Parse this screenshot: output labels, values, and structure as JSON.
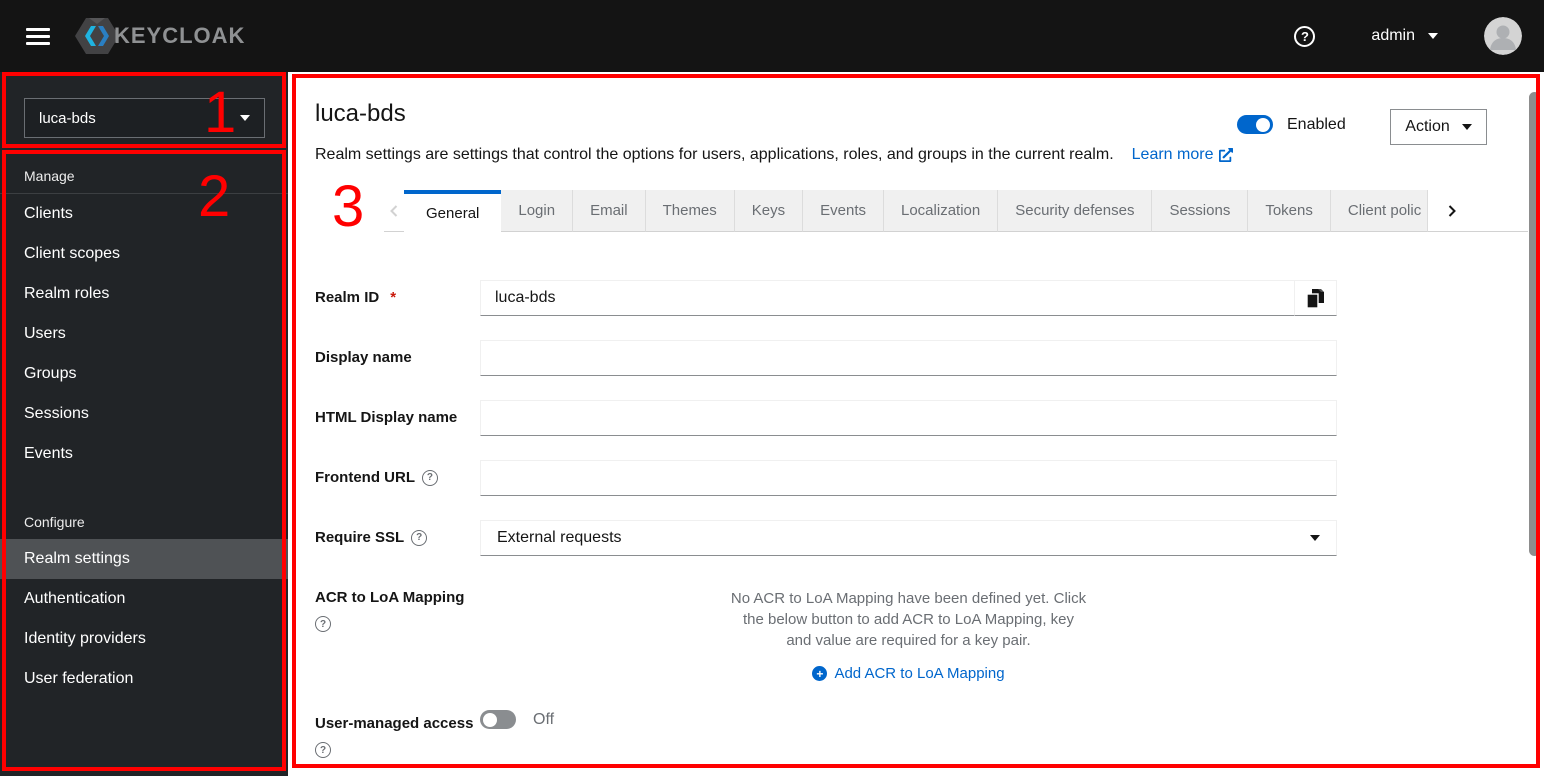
{
  "header": {
    "brand_text": "KEYCLOAK",
    "user_name": "admin"
  },
  "icons": {
    "help": "?",
    "plus": "+"
  },
  "sidebar": {
    "realm_selector": {
      "value": "luca-bds"
    },
    "sections": [
      {
        "title": "Manage",
        "items": [
          {
            "label": "Clients"
          },
          {
            "label": "Client scopes"
          },
          {
            "label": "Realm roles"
          },
          {
            "label": "Users"
          },
          {
            "label": "Groups"
          },
          {
            "label": "Sessions"
          },
          {
            "label": "Events"
          }
        ]
      },
      {
        "title": "Configure",
        "items": [
          {
            "label": "Realm settings",
            "selected": true
          },
          {
            "label": "Authentication"
          },
          {
            "label": "Identity providers"
          },
          {
            "label": "User federation"
          }
        ]
      }
    ]
  },
  "main": {
    "title": "luca-bds",
    "description": "Realm settings are settings that control the options for users, applications, roles, and groups in the current realm.",
    "learn_more_label": "Learn more",
    "enabled_toggle": {
      "label": "Enabled",
      "state": "on"
    },
    "action_button_label": "Action",
    "tabs": {
      "active": "General",
      "items": [
        "General",
        "Login",
        "Email",
        "Themes",
        "Keys",
        "Events",
        "Localization",
        "Security defenses",
        "Sessions",
        "Tokens",
        "Client polic"
      ]
    },
    "form": {
      "realm_id": {
        "label": "Realm ID",
        "required_marker": "*",
        "value": "luca-bds"
      },
      "display_name": {
        "label": "Display name",
        "value": ""
      },
      "html_display_name": {
        "label": "HTML Display name",
        "value": ""
      },
      "frontend_url": {
        "label": "Frontend URL",
        "value": ""
      },
      "require_ssl": {
        "label": "Require SSL",
        "value": "External requests"
      },
      "acr_to_loa": {
        "label": "ACR to LoA Mapping",
        "empty_text": "No ACR to LoA Mapping have been defined yet. Click the below button to add ACR to LoA Mapping, key and value are required for a key pair.",
        "add_button_label": "Add ACR to LoA Mapping"
      },
      "user_managed_access": {
        "label": "User-managed access",
        "state": "Off"
      }
    }
  },
  "annotations": {
    "box1": "1",
    "box2": "2",
    "box3": "3"
  },
  "colors": {
    "accent_blue": "#0066cc",
    "annotation_red": "#ff0000",
    "header_bg": "#141414",
    "sidebar_bg": "#212427",
    "sidebar_selected_bg": "#4f5255",
    "muted_text": "#6a6e73"
  }
}
